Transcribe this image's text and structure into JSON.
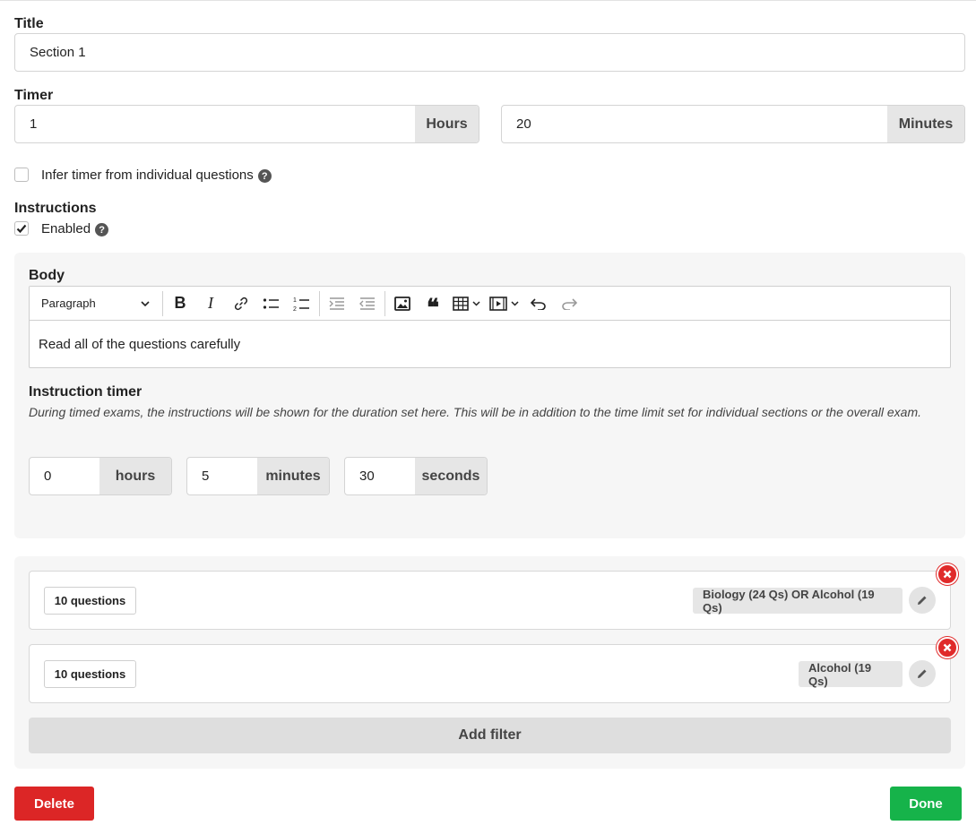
{
  "title_field": {
    "label": "Title",
    "value": "Section 1"
  },
  "timer": {
    "label": "Timer",
    "hours_value": "1",
    "hours_addon": "Hours",
    "minutes_value": "20",
    "minutes_addon": "Minutes"
  },
  "infer_timer": {
    "label": "Infer timer from individual questions",
    "checked": false
  },
  "instructions": {
    "label": "Instructions",
    "enabled_label": "Enabled",
    "enabled_checked": true,
    "body_label": "Body",
    "editor": {
      "block_format": "Paragraph",
      "content": "Read all of the questions carefully",
      "toolbar_icons": [
        "bold-icon",
        "italic-icon",
        "link-icon",
        "bullet-list-icon",
        "numbered-list-icon",
        "indent-icon",
        "outdent-icon",
        "image-icon",
        "blockquote-icon",
        "table-icon",
        "media-icon",
        "undo-icon",
        "redo-icon"
      ]
    },
    "timer_label": "Instruction timer",
    "timer_description": "During timed exams, the instructions will be shown for the duration set here. This will be in addition to the time limit set for individual sections or the overall exam.",
    "hours_value": "0",
    "hours_addon": "hours",
    "minutes_value": "5",
    "minutes_addon": "minutes",
    "seconds_value": "30",
    "seconds_addon": "seconds"
  },
  "filters": [
    {
      "count_label": "10 questions",
      "tag": "Biology (24 Qs) OR Alcohol (19 Qs)"
    },
    {
      "count_label": "10 questions",
      "tag": "Alcohol (19 Qs)"
    }
  ],
  "add_filter_label": "Add filter",
  "delete_label": "Delete",
  "done_label": "Done",
  "colors": {
    "delete": "#dc2626",
    "done": "#16b34a",
    "remove": "#e02a2a"
  }
}
